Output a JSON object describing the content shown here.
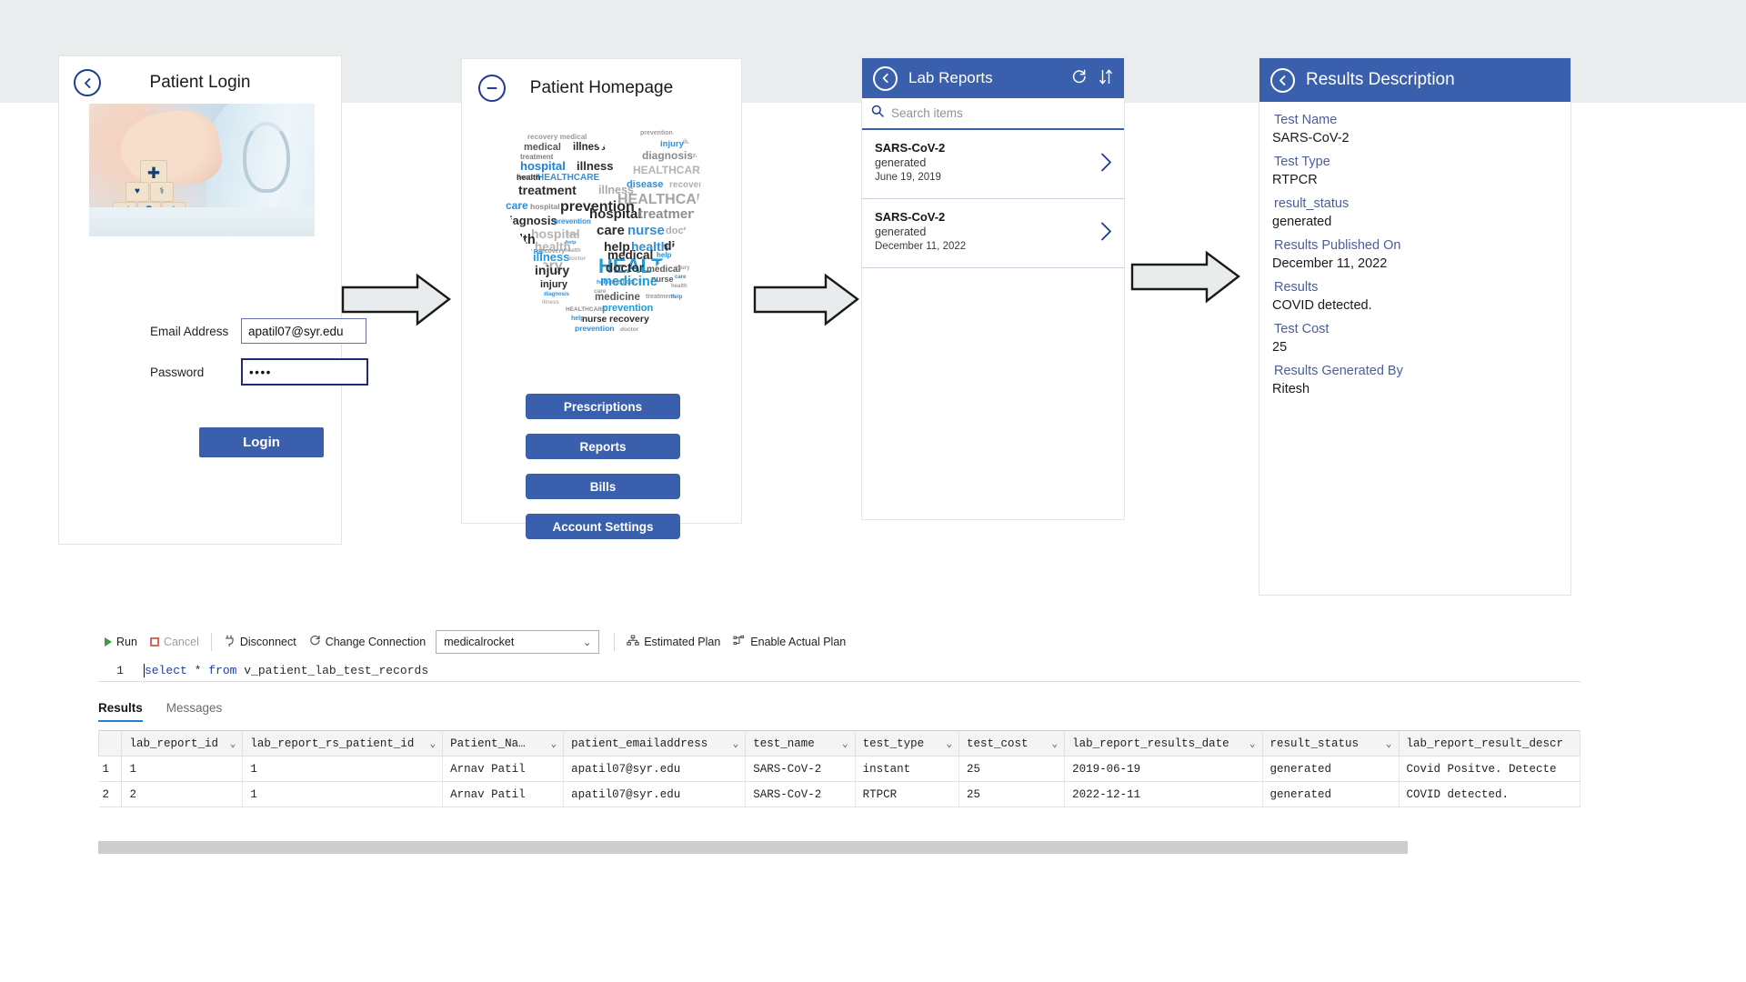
{
  "login_card": {
    "back_icon": "chevron-left-circle-icon",
    "title": "Patient Login",
    "email_label": "Email Address",
    "email_value": "apatil07@syr.edu",
    "email_placeholder": "Email Address",
    "password_label": "Password",
    "password_value": "••••",
    "password_placeholder": "Password",
    "login_button": "Login",
    "photo_alt": "doctor-blocks-photo"
  },
  "home_card": {
    "minus_icon": "minus-circle-icon",
    "title": "Patient Homepage",
    "wordcloud_alt": "healthcare-heart-wordcloud",
    "wordcloud_words": [
      "HEALTHCARE",
      "hospital",
      "prevention",
      "treatment",
      "illness",
      "medical",
      "diagnosis",
      "health",
      "recovery",
      "disease",
      "care",
      "help",
      "nurse",
      "doctor",
      "medicine",
      "injury"
    ],
    "buttons": [
      {
        "label": "Prescriptions",
        "name": "prescriptions-button"
      },
      {
        "label": "Reports",
        "name": "reports-button"
      },
      {
        "label": "Bills",
        "name": "bills-button"
      },
      {
        "label": "Account Settings",
        "name": "account-settings-button"
      }
    ]
  },
  "lab_card": {
    "back_icon": "chevron-left-circle-icon",
    "title": "Lab Reports",
    "refresh_icon": "refresh-icon",
    "sort_icon": "sort-icon",
    "search_icon": "search-icon",
    "search_value": "",
    "search_placeholder": "Search items",
    "items": [
      {
        "name": "SARS-CoV-2",
        "status": "generated",
        "date": "June 19, 2019"
      },
      {
        "name": "SARS-CoV-2",
        "status": "generated",
        "date": "December 11, 2022"
      }
    ]
  },
  "results_card": {
    "back_icon": "chevron-left-circle-icon",
    "title": "Results Description",
    "fields": [
      {
        "key": "Test Name",
        "value": "SARS-CoV-2"
      },
      {
        "key": "Test Type",
        "value": "RTPCR"
      },
      {
        "key": "result_status",
        "value": "generated"
      },
      {
        "key": "Results Published On",
        "value": "December 11, 2022"
      },
      {
        "key": "Results",
        "value": "COVID detected."
      },
      {
        "key": "Test Cost",
        "value": "25"
      },
      {
        "key": "Results Generated By",
        "value": "Ritesh"
      }
    ]
  },
  "sql": {
    "toolbar": {
      "run": "Run",
      "cancel": "Cancel",
      "disconnect": "Disconnect",
      "change_connection": "Change Connection",
      "database": "medicalrocket",
      "estimated_plan": "Estimated Plan",
      "enable_actual_plan": "Enable Actual Plan"
    },
    "editor": {
      "line_number": "1",
      "keyword1": "select",
      "star": "*",
      "keyword2": "from",
      "table": "v_patient_lab_test_records",
      "full_query": "select * from v_patient_lab_test_records"
    },
    "tabs": [
      {
        "label": "Results",
        "active": true
      },
      {
        "label": "Messages",
        "active": false
      }
    ],
    "grid": {
      "columns": [
        "lab_report_id",
        "lab_report_rs_patient_id",
        "Patient_Na…",
        "patient_emailaddress",
        "test_name",
        "test_type",
        "test_cost",
        "lab_report_results_date",
        "result_status",
        "lab_report_result_descr"
      ],
      "rows": [
        {
          "num": "1",
          "cells": [
            "1",
            "1",
            "Arnav Patil",
            "apatil07@syr.edu",
            "SARS-CoV-2",
            "instant",
            "25",
            "2019-06-19",
            "generated",
            "Covid Positve. Detecte"
          ]
        },
        {
          "num": "2",
          "cells": [
            "2",
            "1",
            "Arnav Patil",
            "apatil07@syr.edu",
            "SARS-CoV-2",
            "RTPCR",
            "25",
            "2022-12-11",
            "generated",
            "COVID detected."
          ]
        }
      ]
    }
  },
  "colors": {
    "brand_blue": "#3a5fac",
    "header_blue": "#3a5fac",
    "dark_navy": "#1f3a93",
    "label_blue": "#4a5d9e",
    "band_gray": "#e9edee",
    "scrollbar": "#cdcdcd"
  }
}
